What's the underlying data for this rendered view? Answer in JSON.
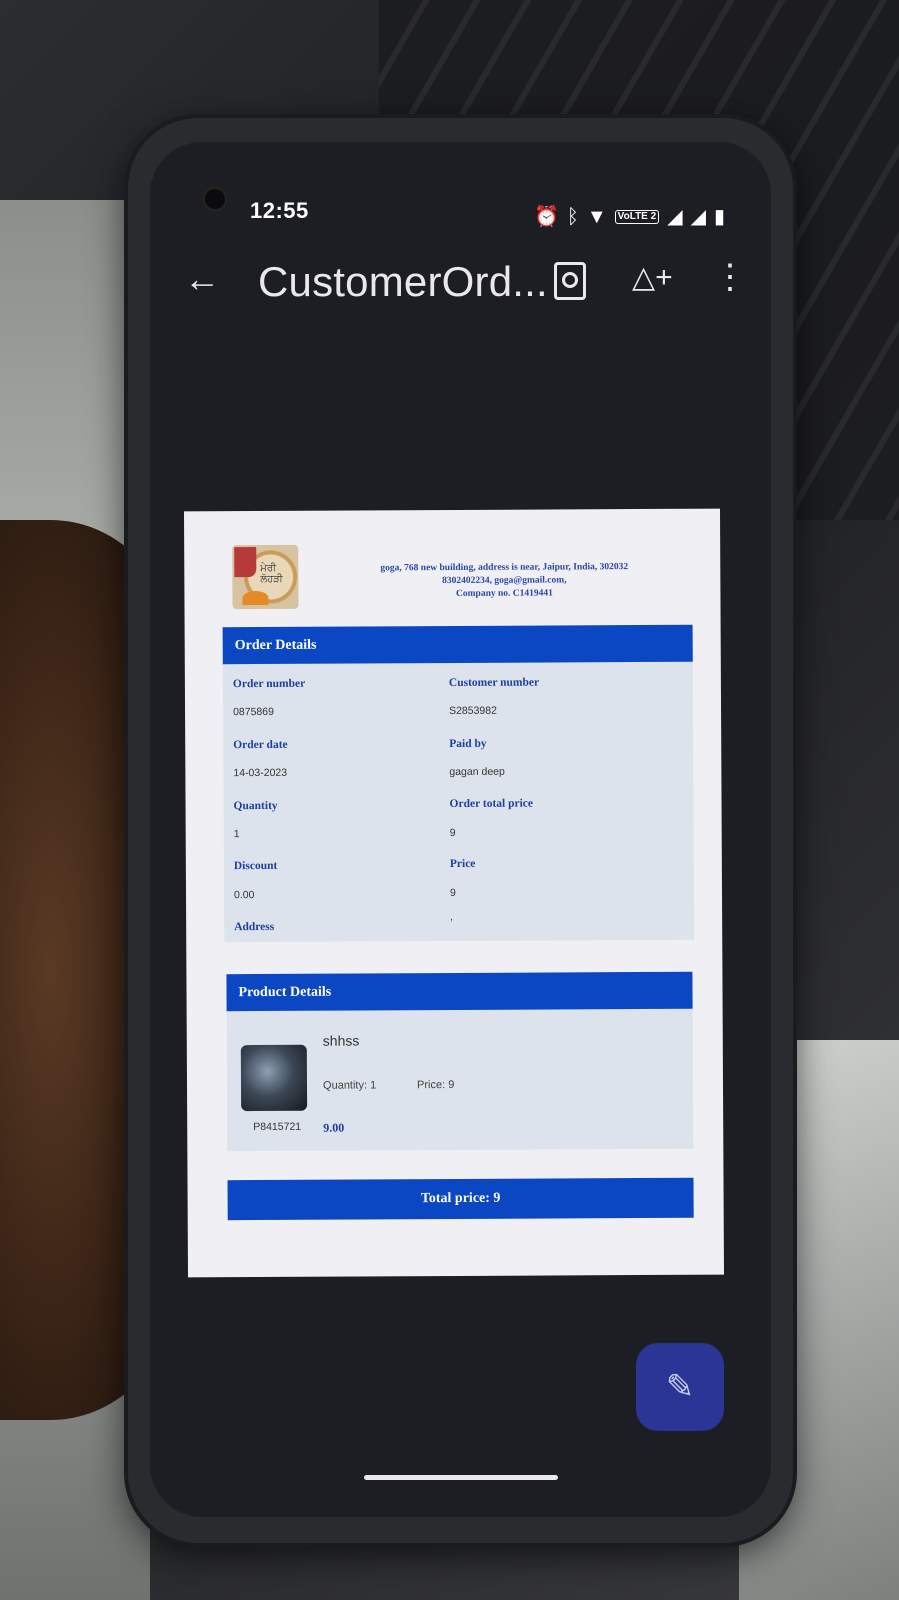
{
  "status_bar": {
    "time": "12:55",
    "volte_label": "VoLTE 2",
    "icons": [
      "alarm-icon",
      "bluetooth-icon",
      "wifi-icon",
      "volte-icon",
      "signal-icon",
      "signal-icon",
      "battery-charging-icon"
    ]
  },
  "app_bar": {
    "title": "CustomerOrd...",
    "icons": [
      "back-arrow-icon",
      "search-document-icon",
      "drive-add-icon",
      "more-vert-icon"
    ]
  },
  "document": {
    "logo_text": "ਮੇਰੀ ਲੋਹੜੀ",
    "company": {
      "line1": "goga, 768 new building, address is near, Jaipur, India, 302032",
      "line2": "8302402234, goga@gmail.com,",
      "line3": "Company no. C1419441"
    },
    "order_details": {
      "header": "Order Details",
      "order_number_label": "Order number",
      "order_number": "0875869",
      "customer_number_label": "Customer number",
      "customer_number": "S2853982",
      "order_date_label": "Order date",
      "order_date": "14-03-2023",
      "paid_by_label": "Paid by",
      "paid_by": "gagan deep",
      "quantity_label": "Quantity",
      "quantity": "1",
      "order_total_price_label": "Order total price",
      "order_total_price": "9",
      "discount_label": "Discount",
      "discount": "0.00",
      "price_label": "Price",
      "price": "9",
      "address_label": "Address",
      "address": ","
    },
    "product_details": {
      "header": "Product Details",
      "name": "shhss",
      "quantity": "Quantity: 1",
      "price": "Price: 9",
      "product_id": "P8415721",
      "amount": "9.00"
    },
    "total": "Total price: 9"
  },
  "fab_icon": "edit-pen-icon",
  "colors": {
    "header_blue": "#0b47c2",
    "label_blue": "#1e3f9c",
    "fab": "#2a3596"
  }
}
